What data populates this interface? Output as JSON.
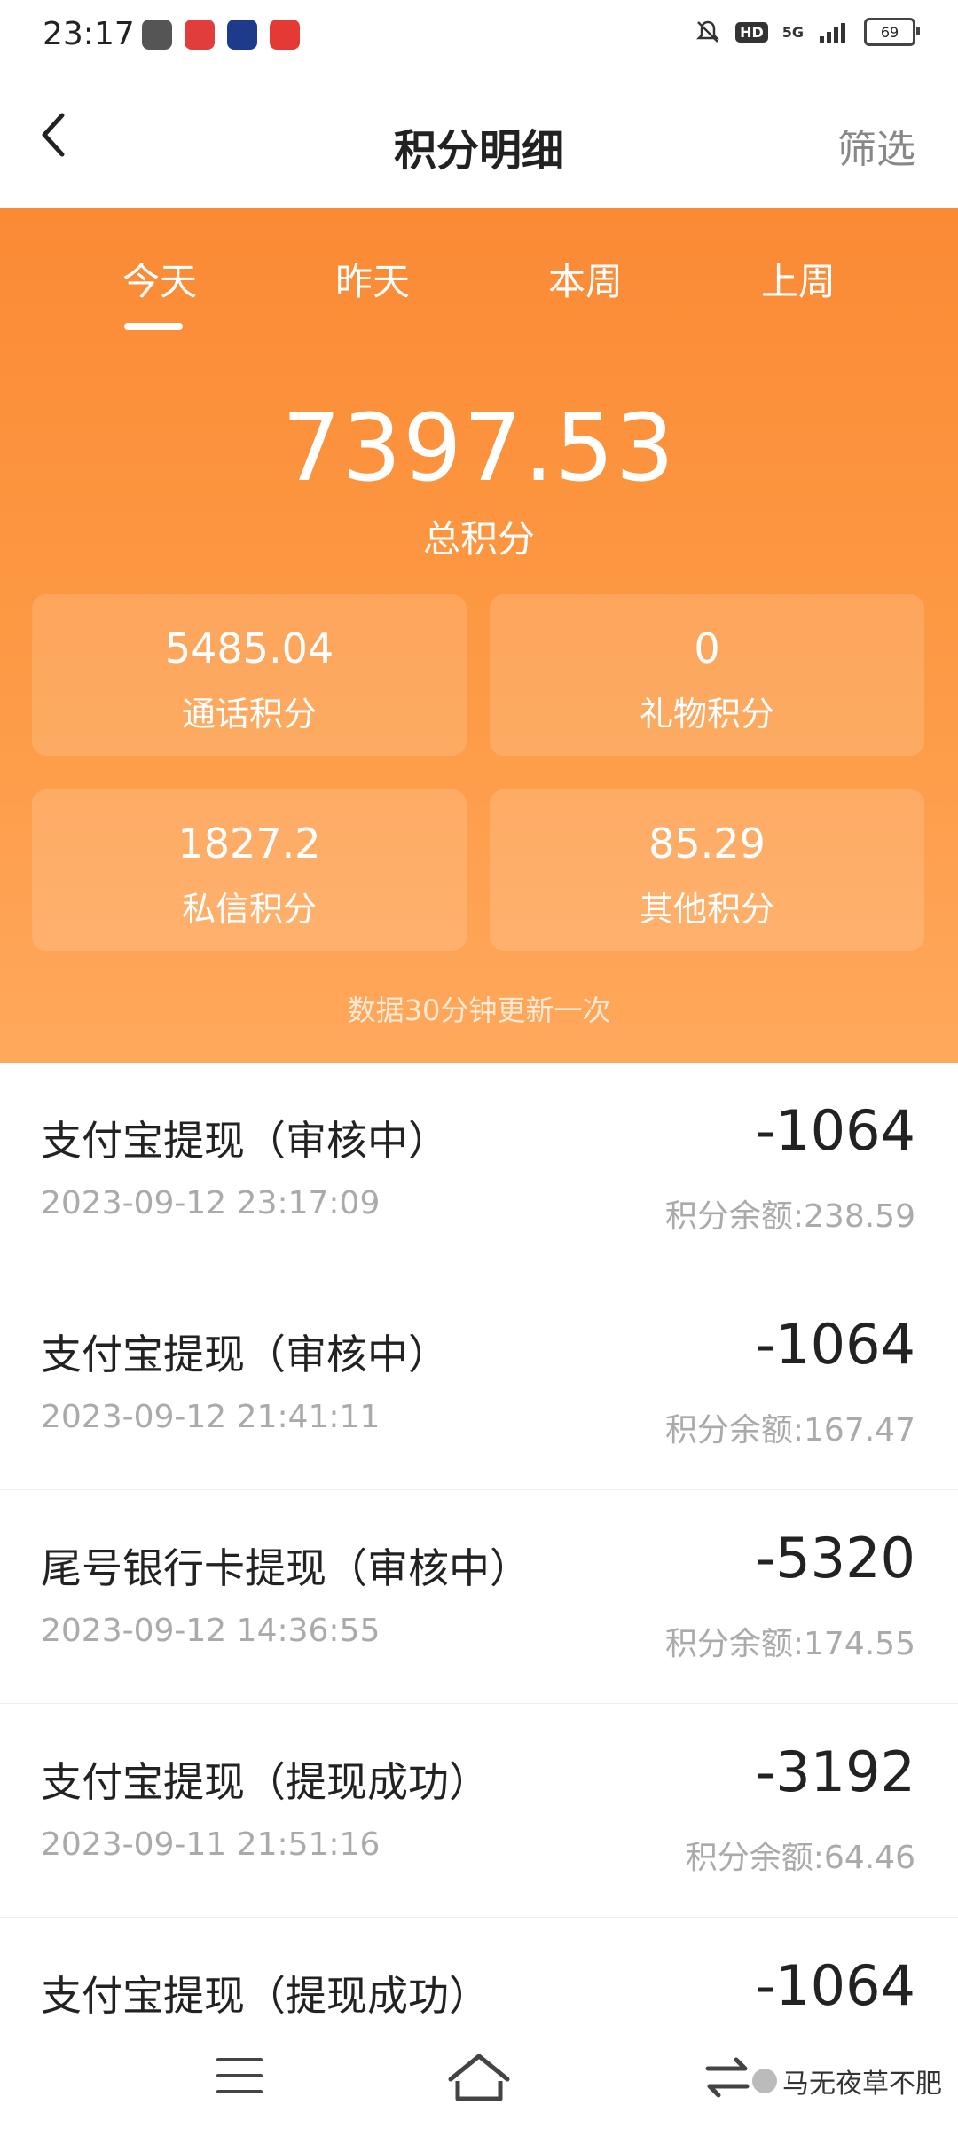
{
  "status": {
    "time": "23:17",
    "apps": [
      {
        "name": "app-icon-1",
        "color": "#555555"
      },
      {
        "name": "app-icon-2",
        "color": "#e23d3d"
      },
      {
        "name": "app-icon-3",
        "color": "#1e3a8a"
      },
      {
        "name": "app-icon-4",
        "color": "#e53935"
      }
    ],
    "network": "5G",
    "hd": "HD",
    "battery": "69"
  },
  "navbar": {
    "back_icon": "‹",
    "title": "积分明细",
    "filter": "筛选"
  },
  "tabs": [
    {
      "label": "今天",
      "active": true
    },
    {
      "label": "昨天",
      "active": false
    },
    {
      "label": "本周",
      "active": false
    },
    {
      "label": "上周",
      "active": false
    }
  ],
  "summary": {
    "total_value": "7397.53",
    "total_label": "总积分",
    "cards": [
      {
        "value": "5485.04",
        "label": "通话积分"
      },
      {
        "value": "0",
        "label": "礼物积分"
      },
      {
        "value": "1827.2",
        "label": "私信积分"
      },
      {
        "value": "85.29",
        "label": "其他积分"
      }
    ],
    "update_note": "数据30分钟更新一次"
  },
  "records": [
    {
      "title": "支付宝提现（审核中）",
      "time": "2023-09-12  23:17:09",
      "amount": "-1064",
      "balance": "积分余额:238.59"
    },
    {
      "title": "支付宝提现（审核中）",
      "time": "2023-09-12  21:41:11",
      "amount": "-1064",
      "balance": "积分余额:167.47"
    },
    {
      "title": "尾号银行卡提现（审核中）",
      "time": "2023-09-12  14:36:55",
      "amount": "-5320",
      "balance": "积分余额:174.55"
    },
    {
      "title": "支付宝提现（提现成功）",
      "time": "2023-09-11  21:51:16",
      "amount": "-3192",
      "balance": "积分余额:64.46"
    },
    {
      "title": "支付宝提现（提现成功）",
      "time": "",
      "amount": "-1064",
      "balance": ""
    }
  ],
  "watermark": "马无夜草不肥",
  "colors": {
    "accent": "#fb8a35",
    "accent_light": "#ffa85c"
  }
}
